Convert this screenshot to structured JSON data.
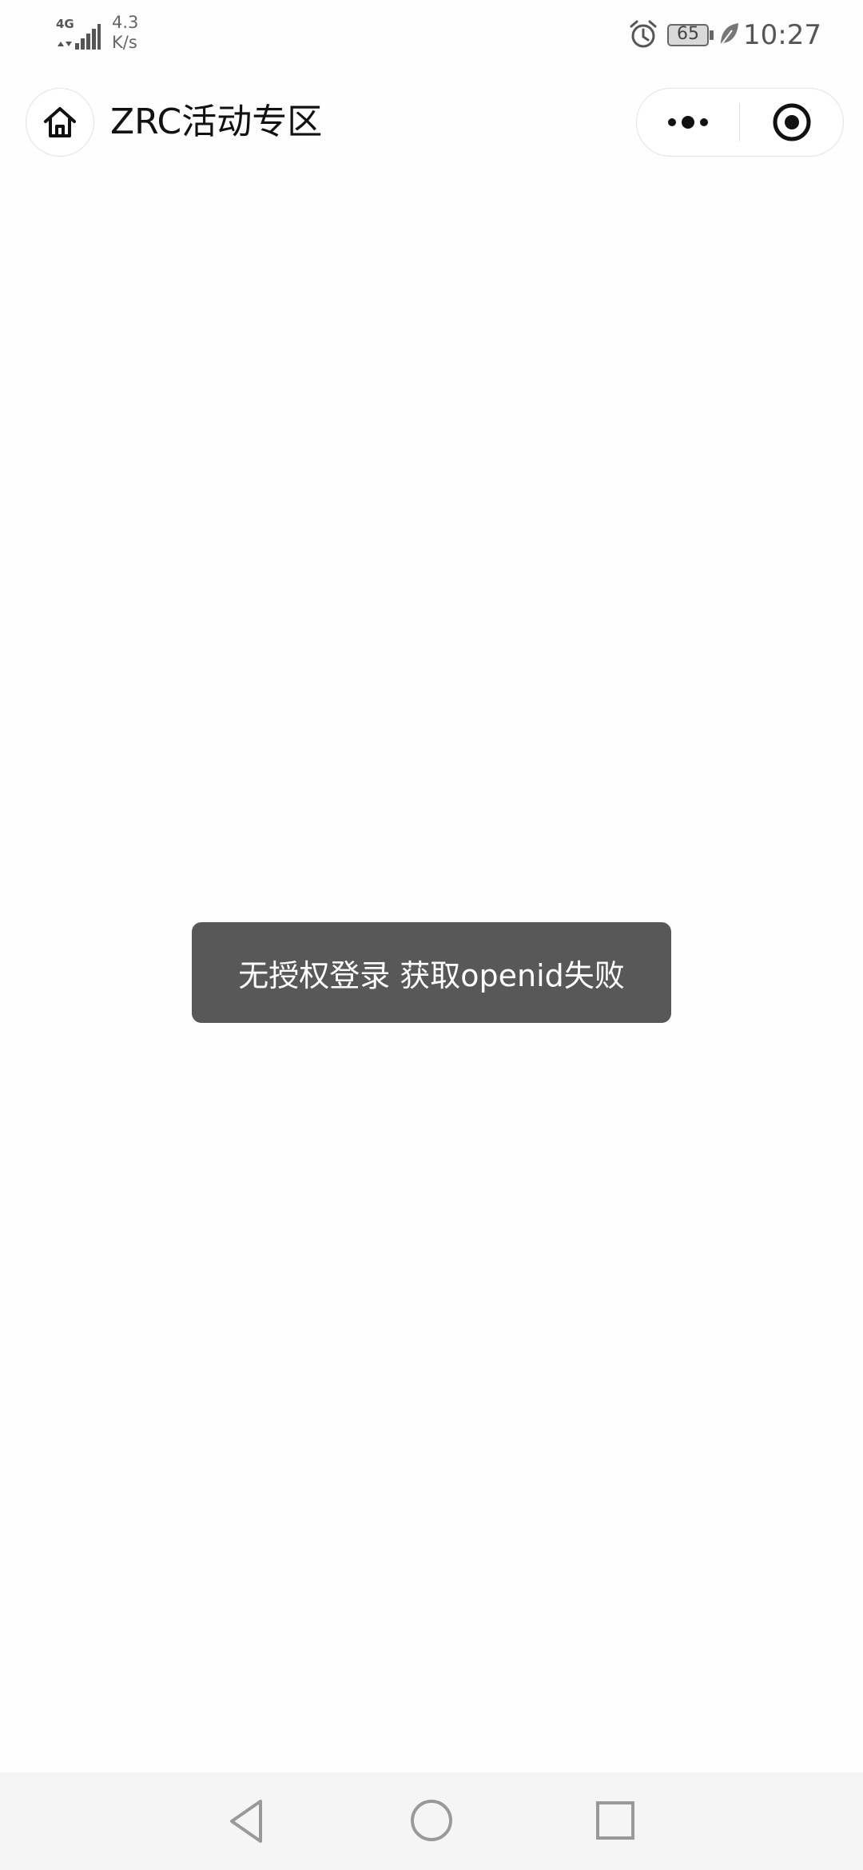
{
  "status_bar": {
    "network_type": "4G",
    "speed_value": "4.3",
    "speed_unit": "K/s",
    "battery_level": "65",
    "time": "10:27",
    "icons": [
      "signal-icon",
      "alarm-icon",
      "battery-icon",
      "leaf-icon"
    ]
  },
  "nav_bar": {
    "title": "ZRC活动专区",
    "icons": [
      "home-icon",
      "more-icon",
      "close-icon"
    ]
  },
  "toast": {
    "message": "无授权登录 获取openid失败"
  },
  "system_nav": {
    "icons": [
      "back-icon",
      "home-circle-icon",
      "recent-apps-icon"
    ]
  },
  "colors": {
    "toast_bg": "#585858",
    "toast_text": "#ffffff",
    "title_text": "#111111",
    "system_nav_bg": "#f5f5f5"
  }
}
